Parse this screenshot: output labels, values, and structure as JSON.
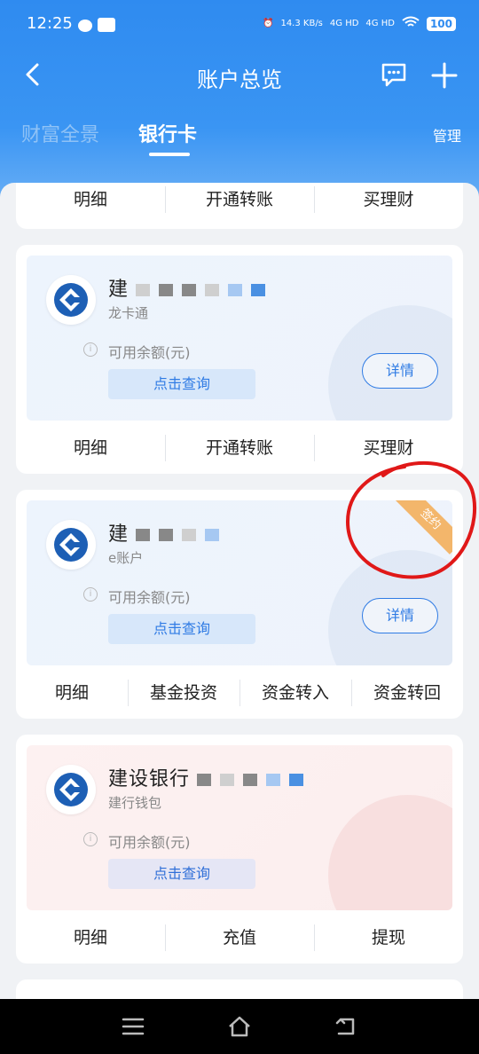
{
  "status_bar": {
    "time": "12:25",
    "net_speed": "14.3 KB/s",
    "signal1": "4G HD",
    "signal2": "4G HD",
    "battery": "100"
  },
  "navbar": {
    "title": "账户总览"
  },
  "tabs": {
    "wealth": "财富全景",
    "bank": "银行卡",
    "manage": "管理"
  },
  "top_card": {
    "actions": [
      "明细",
      "开通转账",
      "买理财"
    ]
  },
  "cards": [
    {
      "name": "建",
      "type": "龙卡通",
      "balance_label": "可用余额(元)",
      "query_label": "点击查询",
      "detail_label": "详情",
      "actions": [
        "明细",
        "开通转账",
        "买理财"
      ]
    },
    {
      "name": "建",
      "type": "e账户",
      "balance_label": "可用余额(元)",
      "query_label": "点击查询",
      "detail_label": "详情",
      "tag": "签约",
      "actions": [
        "明细",
        "基金投资",
        "资金转入",
        "资金转回"
      ]
    },
    {
      "name": "建设银行",
      "type": "建行钱包",
      "balance_label": "可用余额(元)",
      "query_label": "点击查询",
      "actions": [
        "明细",
        "充值",
        "提现"
      ]
    }
  ],
  "colors": {
    "brand_blue": "#2f8bf0",
    "ccb_blue": "#1d5fb5",
    "annotation_red": "#e01818",
    "tag_orange": "#f3b66b"
  }
}
